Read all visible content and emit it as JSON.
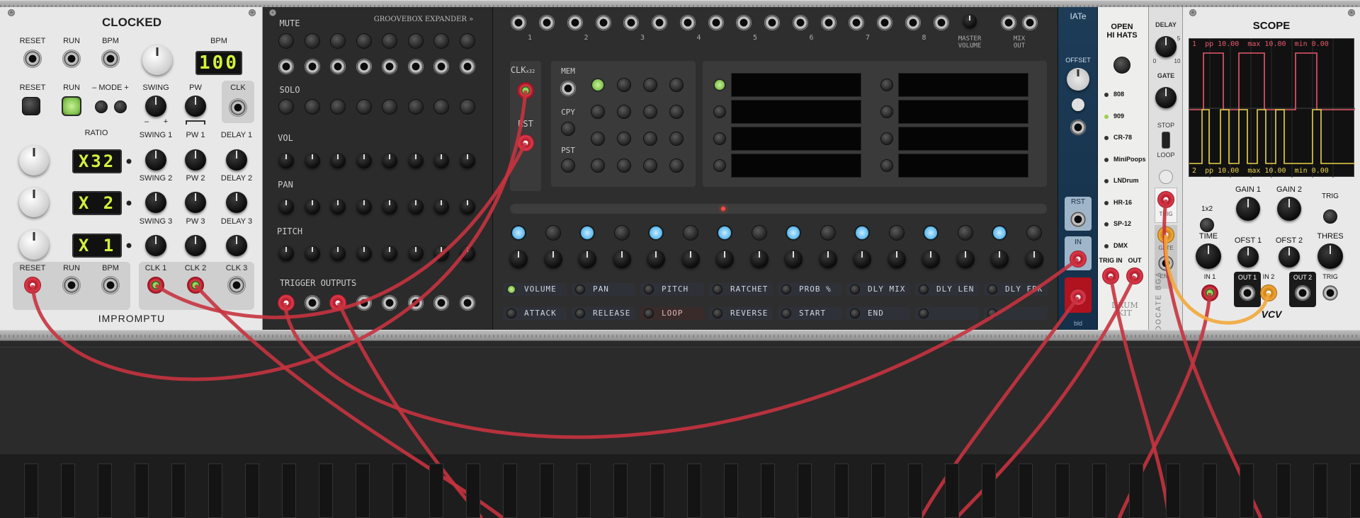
{
  "rack": {
    "accent_cable": "#c7333f",
    "cable_orange": "#f2a93b"
  },
  "clocked": {
    "title": "CLOCKED",
    "brand": "IMPROMPTU",
    "labels": {
      "reset": "RESET",
      "run": "RUN",
      "bpm_in": "BPM",
      "bpm": "BPM",
      "reset2": "RESET",
      "run2": "RUN",
      "mode": "– MODE +",
      "swing": "SWING",
      "pw": "PW",
      "clk": "CLK",
      "ratio": "RATIO",
      "swing1": "SWING 1",
      "pw1": "PW 1",
      "delay1": "DELAY 1",
      "swing2": "SWING 2",
      "pw2": "PW 2",
      "delay2": "DELAY 2",
      "swing3": "SWING 3",
      "pw3": "PW 3",
      "delay3": "DELAY 3",
      "out_reset": "RESET",
      "out_run": "RUN",
      "out_bpm": "BPM",
      "clk1": "CLK 1",
      "clk2": "CLK 2",
      "clk3": "CLK 3",
      "minus": "–",
      "plus": "+"
    },
    "bpm_display": "100",
    "ratio1": "X32",
    "ratio2": "X 2",
    "ratio3": "X 1"
  },
  "groovebox_expander": {
    "header": "GROOVEBOX EXPANDER »",
    "labels": {
      "mute": "MUTE",
      "solo": "SOLO",
      "vol": "VOL",
      "pan": "PAN",
      "pitch": "PITCH",
      "trigger_outputs": "TRIGGER OUTPUTS"
    }
  },
  "groovebox": {
    "top_labels": [
      "1",
      "2",
      "3",
      "4",
      "5",
      "6",
      "7",
      "8"
    ],
    "master_volume": "MASTER\nVOLUME",
    "mix_out": "MIX\nOUT",
    "clk": "CLK",
    "clk_sub": "x32",
    "rst": "RST",
    "mem": "MEM",
    "cpy": "CPY",
    "pst": "PST",
    "functions_row1": [
      "VOLUME",
      "PAN",
      "PITCH",
      "RATCHET",
      "PROB %",
      "DLY MIX",
      "DLY LEN",
      "DLY FBK"
    ],
    "functions_row2": [
      "ATTACK",
      "RELEASE",
      "LOOP",
      "REVERSE",
      "START",
      "END",
      "",
      ""
    ]
  },
  "iate": {
    "title": "IATe",
    "offset": "OFFSET",
    "rst": "RST",
    "in": "IN",
    "brand": "bld"
  },
  "open_hihats": {
    "title": "OPEN\nHI HATS",
    "kits": [
      "808",
      "909",
      "CR-78",
      "MiniPoops",
      "LNDrum",
      "HR-16",
      "SP-12",
      "DMX"
    ],
    "trig_in": "TRIG IN",
    "out": "OUT",
    "brand": "DRUM KIT"
  },
  "gate_module": {
    "delay": "DELAY",
    "gate": "GATE",
    "stop": "STOP",
    "loop": "LOOP",
    "trig": "TRIG",
    "gate_out": "GATE",
    "end": "END",
    "vertical": "DOCATE BGA",
    "scale": [
      "0",
      "5",
      "10"
    ]
  },
  "scope": {
    "title": "SCOPE",
    "ch1": {
      "num": "1",
      "pp": "pp",
      "pp_val": "10.00",
      "max": "max",
      "max_val": "10.00",
      "min": "min",
      "min_val": "0.00"
    },
    "ch2": {
      "num": "2",
      "pp": "pp",
      "pp_val": "10.00",
      "max": "max",
      "max_val": "10.00",
      "min": "min",
      "min_val": "0.00"
    },
    "labels": {
      "x1x2": "1x2",
      "gain1": "GAIN 1",
      "gain2": "GAIN 2",
      "trig": "TRIG",
      "time": "TIME",
      "ofst1": "OFST 1",
      "ofst2": "OFST 2",
      "thres": "THRES",
      "in1": "IN 1",
      "out1": "OUT 1",
      "in2": "IN 2",
      "out2": "OUT 2",
      "trig_in": "TRIG"
    },
    "brand": "VCV",
    "colors": {
      "ch1": "#e8596a",
      "ch2": "#e9d34a"
    }
  }
}
